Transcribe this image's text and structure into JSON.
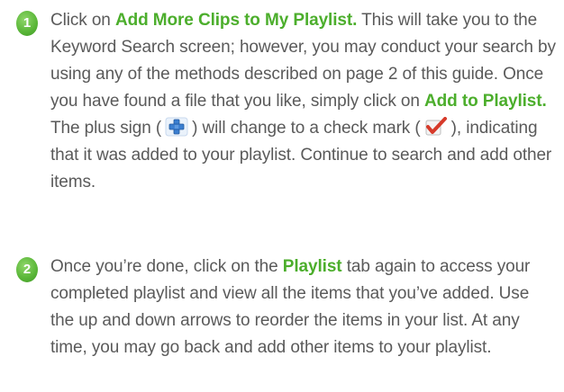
{
  "step1": {
    "number": "1",
    "text_a": "Click on ",
    "link_a": "Add More Clips to My Playlist.",
    "text_b": " This will take you to the Keyword Search screen; however, you may conduct your search by using any of the methods described on page 2 of this guide. Once you have found a file that you like, simply click on ",
    "link_b": "Add to Playlist.",
    "text_c": " The plus sign (",
    "plus_icon": "plus-sign-icon",
    "text_d": ") will change to a check mark (",
    "check_icon": "check-mark-icon",
    "text_e": "), indicating that it was added to your playlist. Continue to search and add other items."
  },
  "step2": {
    "number": "2",
    "text_a": "Once you’re done, click on the ",
    "link_a": "Playlist",
    "text_b": " tab again to access your completed playlist and view all the items that you’ve added. Use the up and down arrows to reorder the items in your list. At any time, you may go back and add other items to your playlist."
  },
  "colors": {
    "accent_green": "#4cae2c",
    "body_text": "#5a5a5a",
    "badge_green": "#5cb83a",
    "plus_blue": "#3b7fd0",
    "check_red": "#d63a2a"
  }
}
